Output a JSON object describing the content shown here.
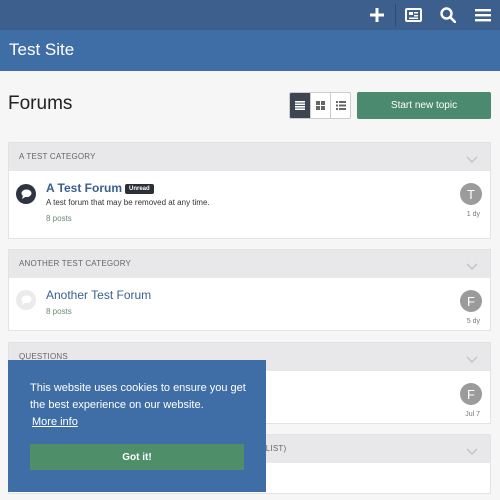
{
  "site": {
    "title": "Test Site"
  },
  "topbar": {
    "icons": [
      "plus-icon",
      "unread-icon",
      "search-icon",
      "menu-icon"
    ]
  },
  "page": {
    "title": "Forums"
  },
  "toolbar": {
    "view_modes": [
      "list-view-icon",
      "grid-view-icon",
      "compact-view-icon"
    ],
    "active_view": "list-view-icon",
    "new_topic_label": "Start new topic"
  },
  "categories": [
    {
      "title": "A TEST CATEGORY",
      "forums": [
        {
          "name": "A Test Forum",
          "badge": "Unread",
          "description": "A test forum that may be removed at any time.",
          "posts": "8 posts",
          "avatar_letter": "T",
          "last_post": "1 dy",
          "unread": true
        }
      ]
    },
    {
      "title": "ANOTHER TEST CATEGORY",
      "forums": [
        {
          "name": "Another Test Forum",
          "posts": "8 posts",
          "avatar_letter": "F",
          "last_post": "5 dy",
          "unread": false
        }
      ]
    },
    {
      "title": "QUESTIONS",
      "forums": [
        {
          "avatar_letter": "F",
          "last_post": "Jul 7"
        }
      ]
    },
    {
      "title_visible_fragment": "L LIST)"
    }
  ],
  "cookie_banner": {
    "message": "This website uses cookies to ensure you get the best experience on our website.",
    "more_info": "More info",
    "accept_label": "Got it!"
  },
  "colors": {
    "topbar": "#3d5f8d",
    "header": "#3f6ea6",
    "primary_button": "#4b8a6e",
    "link": "#3a5f8f"
  }
}
